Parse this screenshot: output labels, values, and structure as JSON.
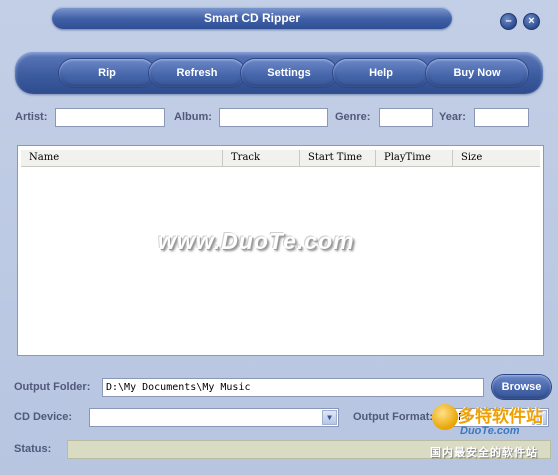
{
  "window": {
    "title": "Smart CD Ripper",
    "minimize_glyph": "–",
    "close_glyph": "×"
  },
  "toolbar": {
    "buttons": [
      "Rip",
      "Refresh",
      "Settings",
      "Help",
      "Buy Now"
    ]
  },
  "tags": {
    "artist_label": "Artist:",
    "album_label": "Album:",
    "genre_label": "Genre:",
    "year_label": "Year:",
    "artist_value": "",
    "album_value": "",
    "genre_value": "",
    "year_value": ""
  },
  "list": {
    "columns": [
      "Name",
      "Track",
      "Start Time",
      "PlayTime",
      "Size"
    ],
    "watermark": "www.DuoTe.com"
  },
  "output": {
    "folder_label": "Output Folder:",
    "folder_value": "D:\\My Documents\\My Music",
    "browse_label": "Browse",
    "device_label": "CD Device:",
    "device_value": "",
    "format_label": "Output Format:",
    "format_value": "MP3",
    "status_label": "Status:",
    "status_value": ""
  },
  "brand_overlay": {
    "line1": "多特软件站",
    "line2": "DuoTe.com",
    "line3": "国内最安全的软件站"
  },
  "colors": {
    "window_bg": "#b7c5e1",
    "button_blue": "#4565aa",
    "label_text": "#51597a"
  }
}
